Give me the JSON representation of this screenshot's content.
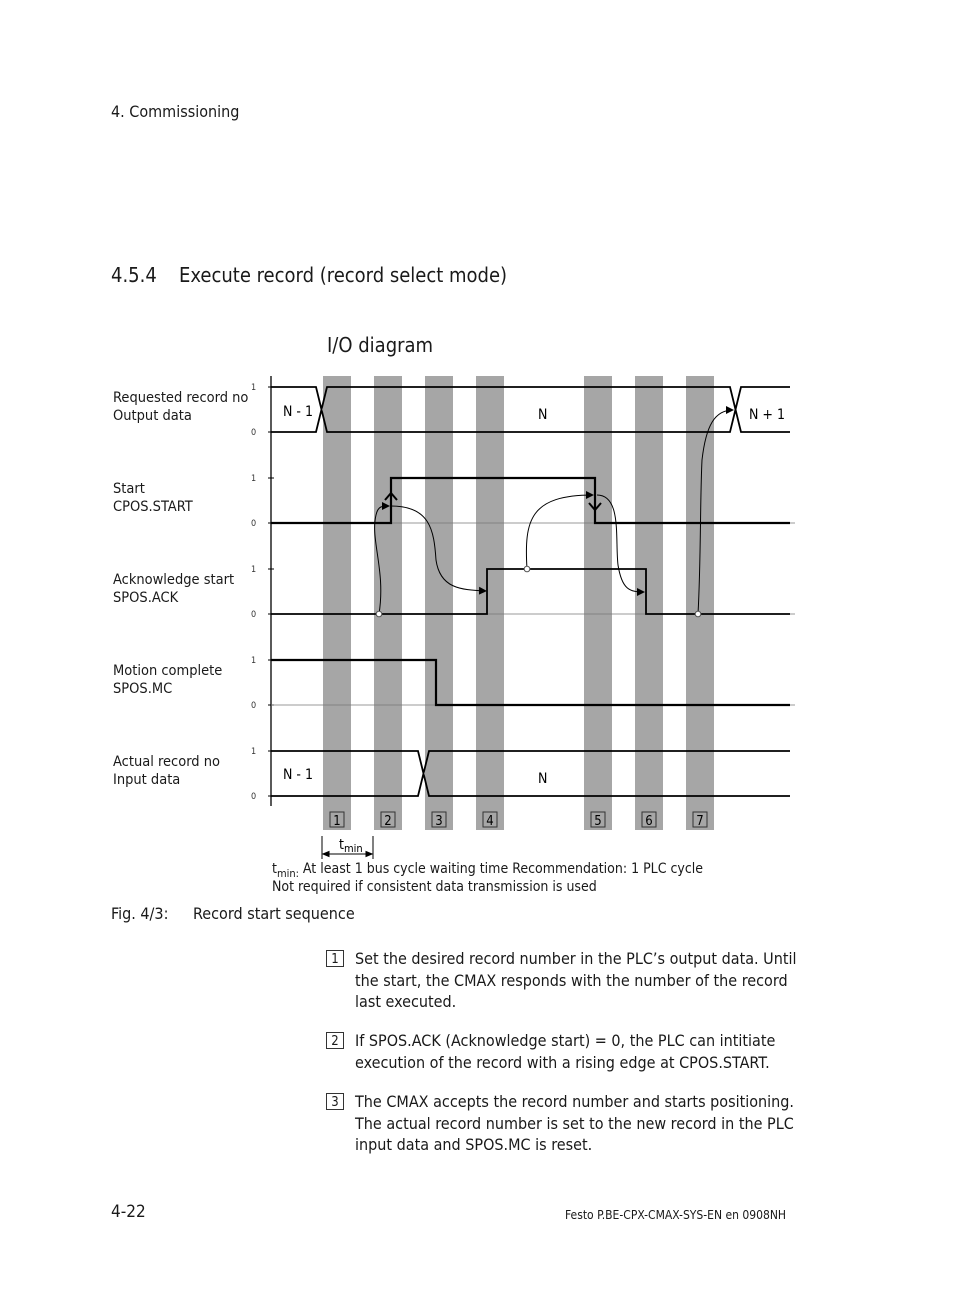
{
  "header": {
    "chapter": "4.  Commissioning"
  },
  "section": {
    "number": "4.5.4",
    "title": "Execute record (record select mode)"
  },
  "diagram": {
    "title": "I/O diagram",
    "level_high": "1",
    "level_low": "0",
    "signals": [
      {
        "label_line1": "Requested record no",
        "label_line2": "Output data",
        "value_before": "N - 1",
        "value_mid": "N",
        "value_after": "N + 1"
      },
      {
        "label_line1": "Start",
        "label_line2": "CPOS.START"
      },
      {
        "label_line1": "Acknowledge start",
        "label_line2": "SPOS.ACK"
      },
      {
        "label_line1": "Motion complete",
        "label_line2": "SPOS.MC"
      },
      {
        "label_line1": "Actual record no",
        "label_line2": "Input data",
        "value_before": "N - 1",
        "value_mid": "N"
      }
    ],
    "steps": [
      "1",
      "2",
      "3",
      "4",
      "5",
      "6",
      "7"
    ],
    "tmin_label": "t",
    "tmin_sub": "min",
    "note_prefix": "t",
    "note_prefix_sub": "min:",
    "note_line1": " At least 1 bus cycle waiting time Recommendation: 1 PLC cycle",
    "note_line2": "Not required if consistent data transmission is used"
  },
  "figure": {
    "number": "Fig. 4/3:",
    "caption": "Record start sequence"
  },
  "steps_text": [
    {
      "n": "1",
      "text": "Set the desired record number in the PLC’s output data. Until the start, the CMAX responds with the number of the record last executed."
    },
    {
      "n": "2",
      "text": "If SPOS.ACK (Acknowledge start) = 0, the PLC can intitiate execution of the record with a rising edge at CPOS.START."
    },
    {
      "n": "3",
      "text": "The CMAX accepts the record number and starts positioning. The actual record number is set to the new record in the PLC input data and SPOS.MC is reset."
    }
  ],
  "footer": {
    "page": "4-22",
    "reference": "Festo  P.BE-CPX-CMAX-SYS-EN  en 0908NH"
  },
  "colors": {
    "band": "#a6a6a6",
    "line": "#000000",
    "text": "#1a1a1a"
  }
}
